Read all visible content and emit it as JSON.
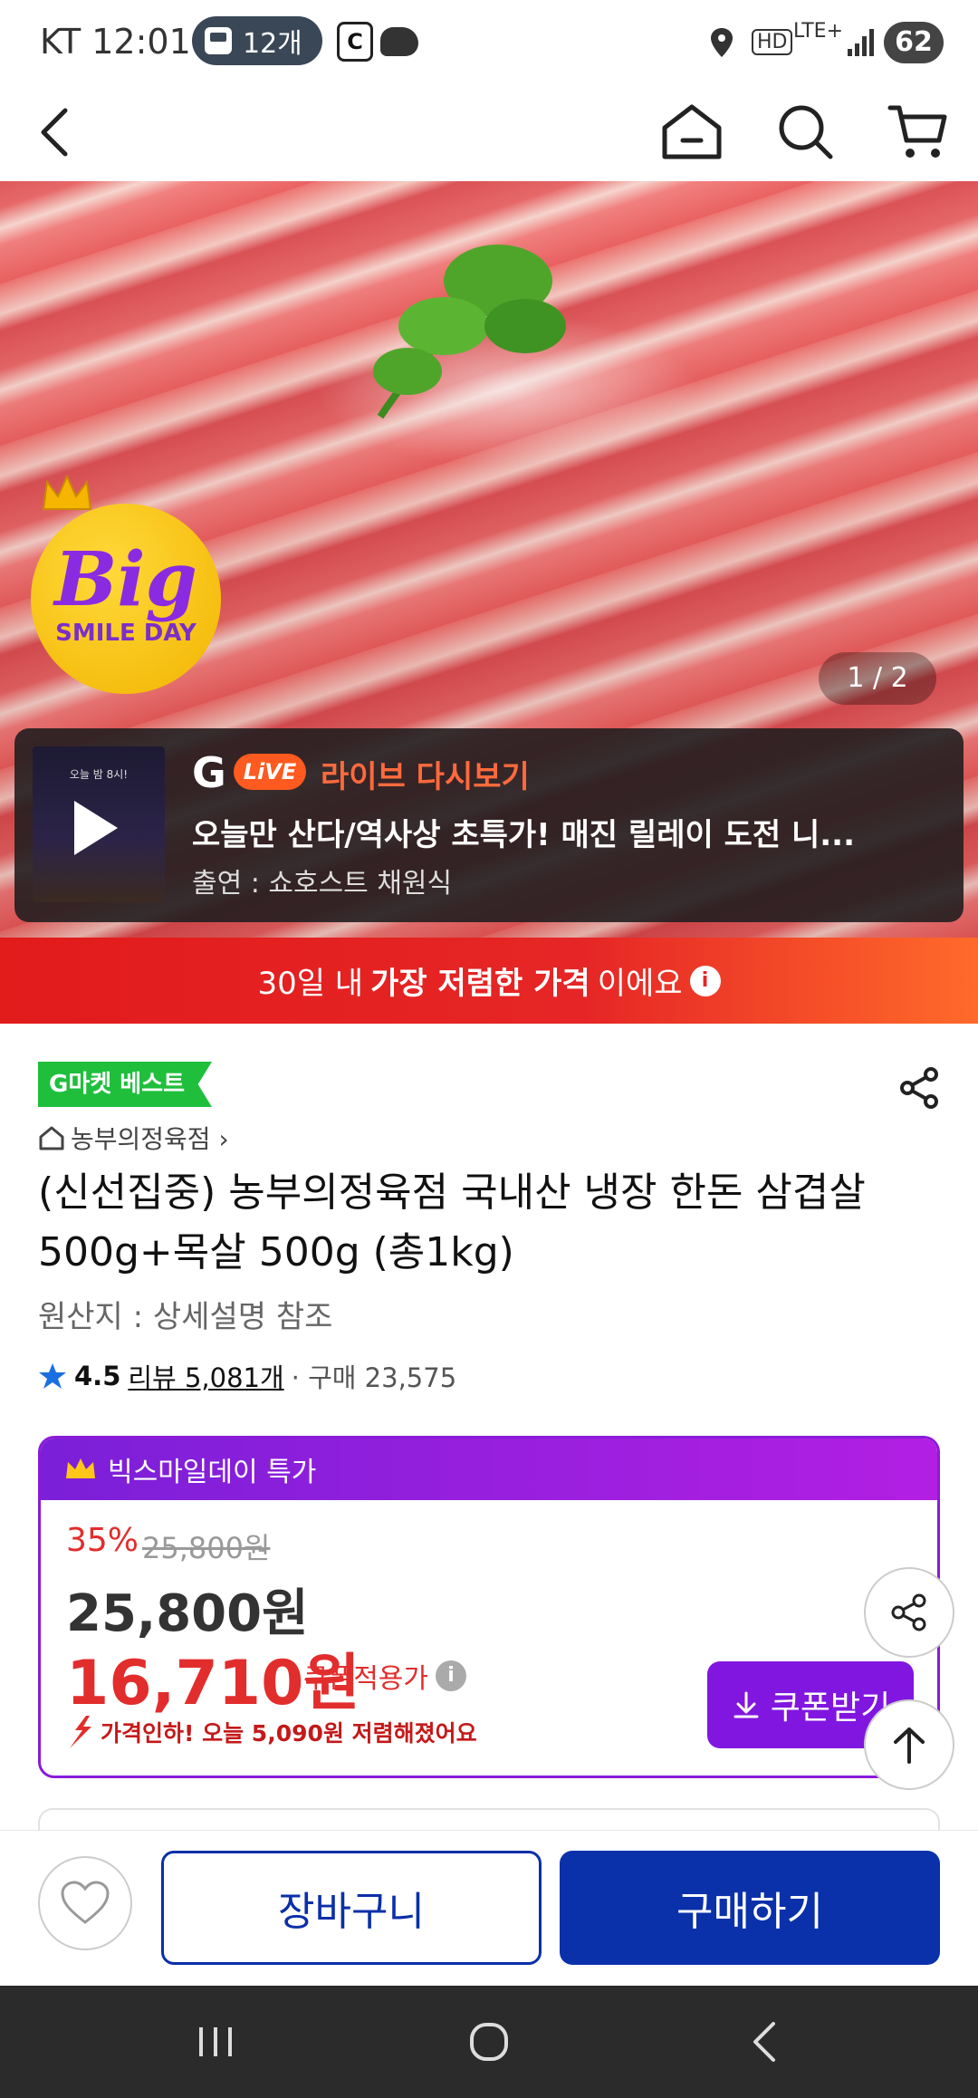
{
  "status": {
    "carrier_time": "KT 12:01",
    "bus_count": "12개",
    "network": "LTE+",
    "hd": "HD",
    "battery": "62"
  },
  "hero": {
    "pager": "1 / 2",
    "badge_word": "Big",
    "badge_sub": "SMILE DAY",
    "live": {
      "brand": "G",
      "pill": "LiVE",
      "label": "라이브 다시보기",
      "title": "오늘만 산다/역사상 초특가! 매진 릴레이 도전 니...",
      "host": "출연 : 쇼호스트 채원식",
      "thumb_text": "오늘 밤 8시!"
    }
  },
  "banner": {
    "prefix": "30일 내 ",
    "bold": "가장 저렴한 가격",
    "suffix": "이에요",
    "info": "i"
  },
  "product": {
    "badge": "G마켓 베스트",
    "store": "농부의정육점 ›",
    "title": "(신선집중) 농부의정육점 국내산 냉장 한돈 삼겹살 500g+목살 500g (총1kg)",
    "origin": "원산지 : 상세설명 참조",
    "rating": "4.5",
    "reviews": "리뷰 5,081개",
    "purchases": "· 구매 23,575"
  },
  "deal": {
    "header": "빅스마일데이 특가",
    "discount": "35%",
    "original_price": "25,800원",
    "price": "25,800원",
    "coupon_price": "16,710원",
    "coupon_note": "쿠폰적용가",
    "drop_note": "가격인하! 오늘 5,090원 저렴해졌어요",
    "coupon_button": "쿠폰받기"
  },
  "bottom": {
    "cart": "장바구니",
    "buy": "구매하기"
  },
  "colors": {
    "accent_blue": "#0a31aa",
    "deal_purple": "#8116e0",
    "price_red": "#e22d2d",
    "best_green": "#1fbf3c"
  }
}
